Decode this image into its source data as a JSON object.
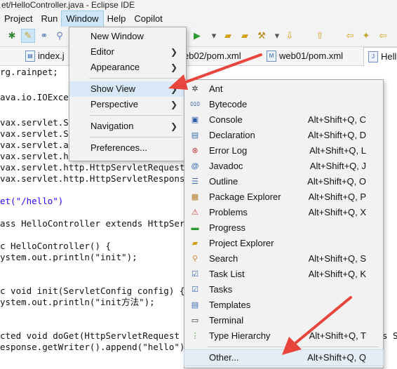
{
  "window": {
    "title": "et/HelloController.java - Eclipse IDE"
  },
  "menubar": [
    "Project",
    "Run",
    "Window",
    "Help",
    "Copilot"
  ],
  "tabs": [
    {
      "label": "index.j"
    },
    {
      "label": "eb02/pom.xml"
    },
    {
      "label": "web01/pom.xml"
    },
    {
      "label": "Hello"
    }
  ],
  "code_lines": [
    "rg.rainpet;",
    "",
    "ava.io.IOExcep",
    "",
    "vax.servlet.S",
    "vax.servlet.S",
    "vax.servlet.a",
    "vax.servlet.h",
    "vax.servlet.http.HttpServletRequest;",
    "vax.servlet.http.HttpServletResponse;",
    "",
    "et(\"/hello\")",
    "",
    "ass HelloController extends HttpServl",
    "",
    "c HelloController() {",
    "ystem.out.println(\"init\");",
    "",
    "",
    "c void init(ServletConfig config) {",
    "ystem.out.println(\"init方法\");",
    "",
    "",
    "cted void doGet(HttpServletRequest re",
    "esponse.getWriter().append(\"hello\");"
  ],
  "code_trailing": {
    "line23": "s S"
  },
  "window_menu": {
    "items": [
      {
        "label": "New Window",
        "submenu": false
      },
      {
        "label": "Editor",
        "submenu": true
      },
      {
        "label": "Appearance",
        "submenu": true
      },
      {
        "label": "Show View",
        "submenu": true,
        "highlighted": true
      },
      {
        "label": "Perspective",
        "submenu": true
      },
      {
        "label": "Navigation",
        "submenu": true
      },
      {
        "label": "Preferences...",
        "submenu": false
      }
    ]
  },
  "show_view_menu": {
    "items": [
      {
        "label": "Ant",
        "shortcut": "",
        "icon": "ant-icon"
      },
      {
        "label": "Bytecode",
        "shortcut": "",
        "icon": "bytecode-icon"
      },
      {
        "label": "Console",
        "shortcut": "Alt+Shift+Q, C",
        "icon": "console-icon"
      },
      {
        "label": "Declaration",
        "shortcut": "Alt+Shift+Q, D",
        "icon": "declaration-icon"
      },
      {
        "label": "Error Log",
        "shortcut": "Alt+Shift+Q, L",
        "icon": "error-log-icon"
      },
      {
        "label": "Javadoc",
        "shortcut": "Alt+Shift+Q, J",
        "icon": "javadoc-icon"
      },
      {
        "label": "Outline",
        "shortcut": "Alt+Shift+Q, O",
        "icon": "outline-icon"
      },
      {
        "label": "Package Explorer",
        "shortcut": "Alt+Shift+Q, P",
        "icon": "package-explorer-icon"
      },
      {
        "label": "Problems",
        "shortcut": "Alt+Shift+Q, X",
        "icon": "problems-icon"
      },
      {
        "label": "Progress",
        "shortcut": "",
        "icon": "progress-icon"
      },
      {
        "label": "Project Explorer",
        "shortcut": "",
        "icon": "project-explorer-icon"
      },
      {
        "label": "Search",
        "shortcut": "Alt+Shift+Q, S",
        "icon": "search-icon"
      },
      {
        "label": "Task List",
        "shortcut": "Alt+Shift+Q, K",
        "icon": "task-list-icon"
      },
      {
        "label": "Tasks",
        "shortcut": "",
        "icon": "tasks-icon"
      },
      {
        "label": "Templates",
        "shortcut": "",
        "icon": "templates-icon"
      },
      {
        "label": "Terminal",
        "shortcut": "",
        "icon": "terminal-icon"
      },
      {
        "label": "Type Hierarchy",
        "shortcut": "Alt+Shift+Q, T",
        "icon": "type-hierarchy-icon"
      }
    ],
    "other": {
      "label": "Other...",
      "shortcut": "Alt+Shift+Q, Q"
    }
  },
  "colors": {
    "annotation_arrow": "#e8453c",
    "menu_highlight": "#d9e8f6",
    "menu_bg": "#f2f2f2"
  }
}
